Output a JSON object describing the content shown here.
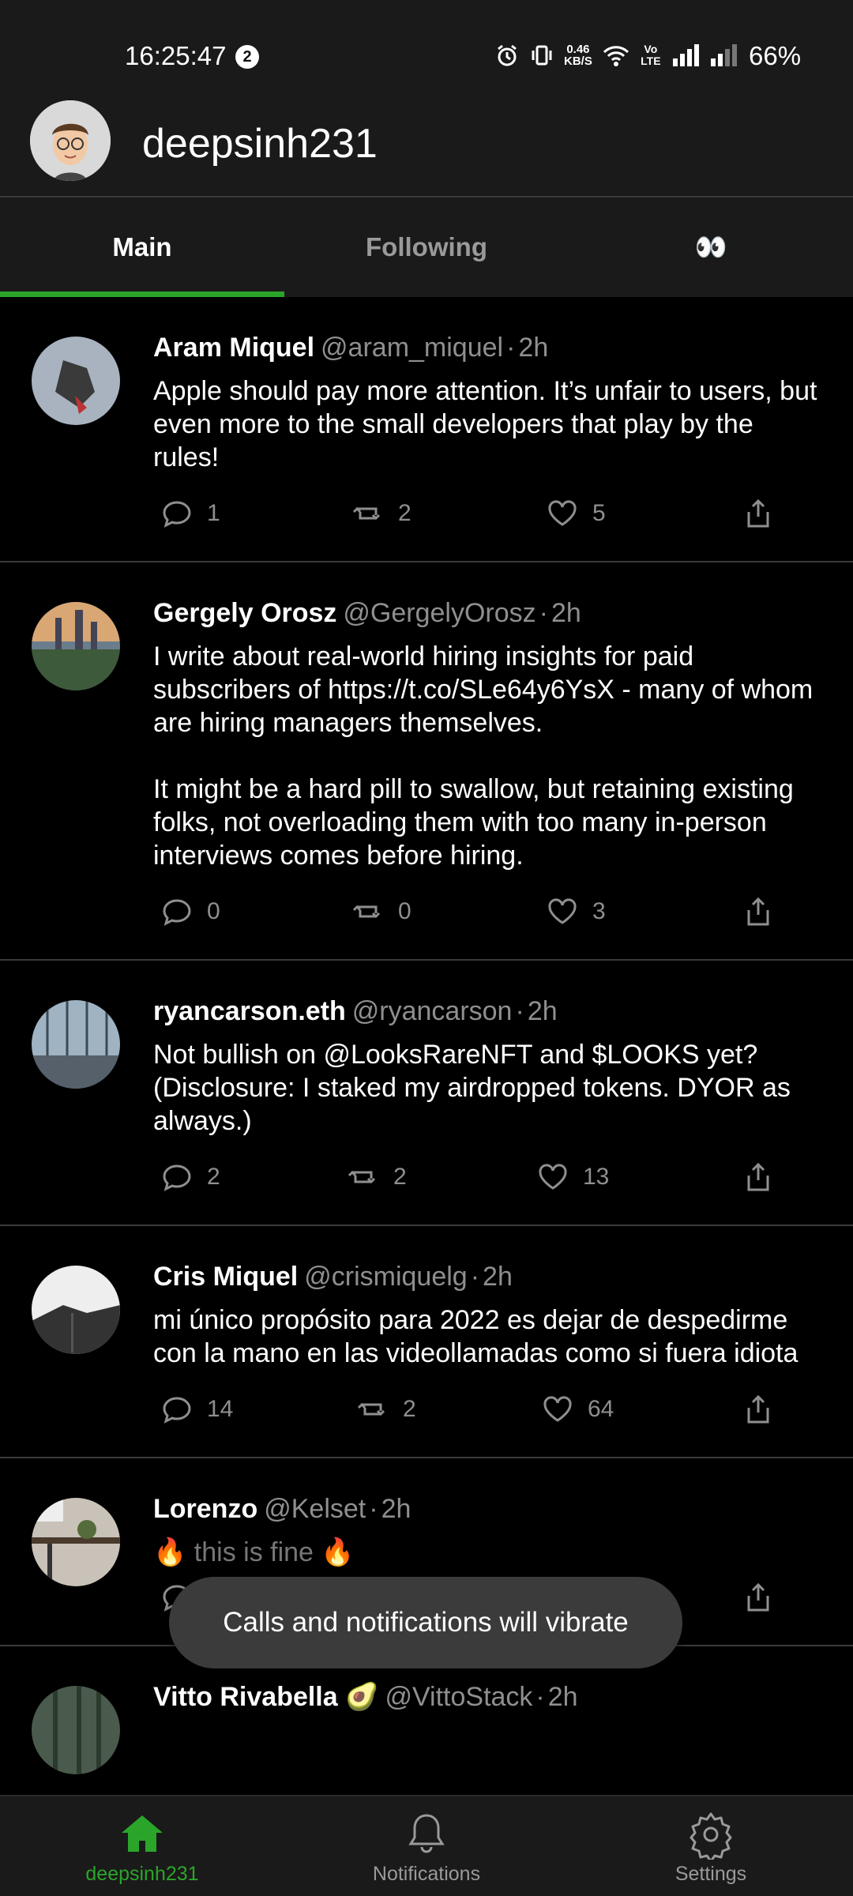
{
  "status_bar": {
    "time": "16:25:47",
    "notification_count": "2",
    "net_speed_value": "0.46",
    "net_speed_unit": "KB/S",
    "volte_label": "Vo LTE",
    "battery": "66%"
  },
  "header": {
    "username": "deepsinh231"
  },
  "tabs": [
    {
      "label": "Main",
      "active": true
    },
    {
      "label": "Following",
      "active": false
    },
    {
      "label": "👀",
      "active": false
    }
  ],
  "tweets": [
    {
      "name": "Aram Miquel",
      "handle": "@aram_miquel",
      "time": "2h",
      "text": "Apple should pay more attention. It’s unfair to users, but even more to the small developers that play by the rules!",
      "replies": "1",
      "retweets": "2",
      "likes": "5"
    },
    {
      "name": "Gergely Orosz",
      "handle": "@GergelyOrosz",
      "time": "2h",
      "text": "I write about real-world hiring insights for paid subscribers of https://t.co/SLe64y6YsX - many of whom are hiring managers themselves.\n\nIt might be a hard pill to swallow, but retaining existing folks, not overloading them with too many in-person interviews comes before hiring.",
      "replies": "0",
      "retweets": "0",
      "likes": "3"
    },
    {
      "name": "ryancarson.eth",
      "handle": "@ryancarson",
      "time": "2h",
      "text": "Not bullish on @LooksRareNFT and $LOOKS yet? (Disclosure: I staked my airdropped tokens. DYOR as always.)",
      "replies": "2",
      "retweets": "2",
      "likes": "13"
    },
    {
      "name": "Cris Miquel",
      "handle": "@crismiquelg",
      "time": "2h",
      "text": "mi único propósito para 2022 es dejar de despedirme con la mano en las videollamadas como si fuera idiota",
      "replies": "14",
      "retweets": "2",
      "likes": "64"
    },
    {
      "name": "Lorenzo",
      "handle": "@Kelset",
      "time": "2h",
      "text": "🔥 this is fine 🔥",
      "replies": "",
      "retweets": "",
      "likes": ""
    },
    {
      "name": "Vitto Rivabella 🥑",
      "handle": "@VittoStack",
      "time": "2h",
      "text": "",
      "replies": "",
      "retweets": "",
      "likes": ""
    }
  ],
  "separator": "·",
  "toast": {
    "message": "Calls and notifications will vibrate"
  },
  "bottom_nav": [
    {
      "label": "deepsinh231",
      "icon": "home-icon",
      "active": true
    },
    {
      "label": "Notifications",
      "icon": "bell-icon",
      "active": false
    },
    {
      "label": "Settings",
      "icon": "gear-icon",
      "active": false
    }
  ],
  "colors": {
    "accent": "#2aa52a",
    "background": "#000000",
    "surface": "#1a1a1a",
    "muted_text": "#8f8f8f"
  }
}
